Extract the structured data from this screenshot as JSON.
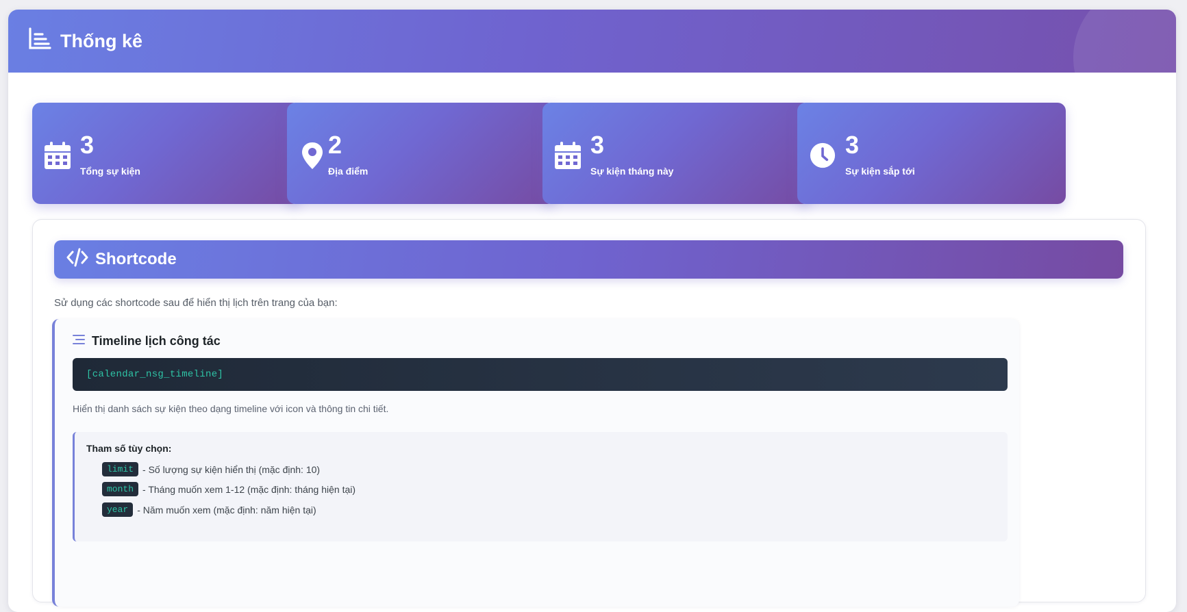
{
  "header": {
    "title": "Thống kê",
    "icon": "chart-icon"
  },
  "stats": [
    {
      "value": "3",
      "label": "Tổng sự kiện",
      "icon": "calendar-icon"
    },
    {
      "value": "2",
      "label": "Địa điểm",
      "icon": "map-pin-icon"
    },
    {
      "value": "3",
      "label": "Sự kiện tháng này",
      "icon": "calendar-icon"
    },
    {
      "value": "3",
      "label": "Sự kiện sắp tới",
      "icon": "clock-icon"
    }
  ],
  "shortcode_section": {
    "title": "Shortcode",
    "icon": "code-icon",
    "intro": "Sử dụng các shortcode sau để hiển thị lịch trên trang của bạn:",
    "blocks": [
      {
        "title": "Timeline lịch công tác",
        "icon": "list-icon",
        "code": "[calendar_nsg_timeline]",
        "description": "Hiển thị danh sách sự kiện theo dạng timeline với icon và thông tin chi tiết.",
        "params_title": "Tham số tùy chọn:",
        "params": [
          {
            "name": "limit",
            "text": "- Số lượng sự kiện hiển thị (mặc định: 10)"
          },
          {
            "name": "month",
            "text": "- Tháng muốn xem 1-12 (mặc định: tháng hiện tại)"
          },
          {
            "name": "year",
            "text": "- Năm muốn xem (mặc định: năm hiện tại)"
          }
        ]
      }
    ]
  },
  "colors": {
    "gradient_start": "#6a7fe3",
    "gradient_end": "#764ba2",
    "code_bg": "#1f2937",
    "code_text": "#2ec4a6"
  }
}
